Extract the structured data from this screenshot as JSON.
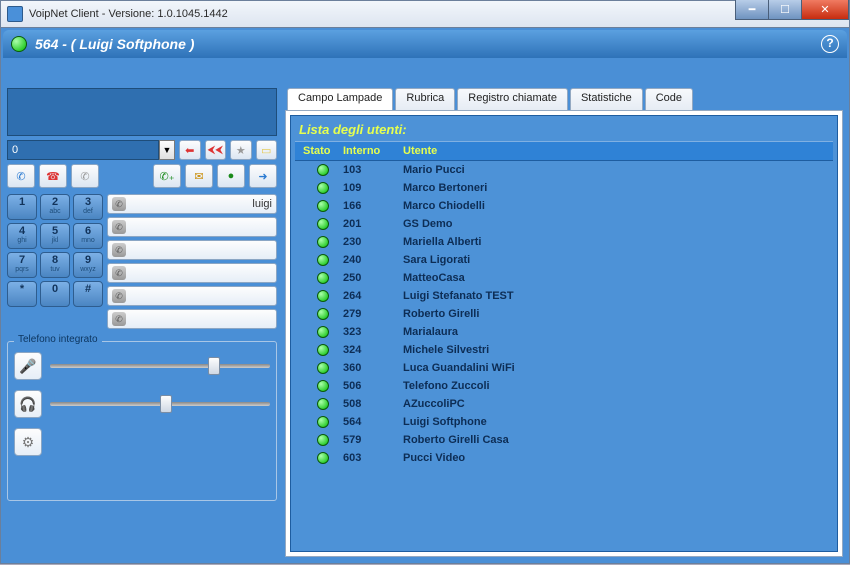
{
  "window": {
    "title": "VoipNet Client - Versione: 1.0.1045.1442"
  },
  "header": {
    "title": "564 - ( Luigi Softphone )"
  },
  "left": {
    "number_input": "0",
    "presence_first": "luigi",
    "dialkeys": [
      {
        "d": "1",
        "s": ""
      },
      {
        "d": "2",
        "s": "abc"
      },
      {
        "d": "3",
        "s": "def"
      },
      {
        "d": "4",
        "s": "ghi"
      },
      {
        "d": "5",
        "s": "jkl"
      },
      {
        "d": "6",
        "s": "mno"
      },
      {
        "d": "7",
        "s": "pqrs"
      },
      {
        "d": "8",
        "s": "tuv"
      },
      {
        "d": "9",
        "s": "wxyz"
      },
      {
        "d": "*",
        "s": ""
      },
      {
        "d": "0",
        "s": ""
      },
      {
        "d": "#",
        "s": ""
      }
    ],
    "group_label": "Telefono integrato",
    "mic_pos_pct": 72,
    "spk_pos_pct": 50
  },
  "tabs": [
    "Campo Lampade",
    "Rubrica",
    "Registro chiamate",
    "Statistiche",
    "Code"
  ],
  "list": {
    "panel_title": "Lista degli utenti:",
    "headers": {
      "stato": "Stato",
      "interno": "Interno",
      "utente": "Utente"
    },
    "rows": [
      {
        "interno": "103",
        "utente": "Mario Pucci"
      },
      {
        "interno": "109",
        "utente": "Marco Bertoneri"
      },
      {
        "interno": "166",
        "utente": "Marco Chiodelli"
      },
      {
        "interno": "201",
        "utente": "GS Demo"
      },
      {
        "interno": "230",
        "utente": "Mariella Alberti"
      },
      {
        "interno": "240",
        "utente": "Sara Ligorati"
      },
      {
        "interno": "250",
        "utente": "MatteoCasa"
      },
      {
        "interno": "264",
        "utente": "Luigi Stefanato TEST"
      },
      {
        "interno": "279",
        "utente": "Roberto Girelli"
      },
      {
        "interno": "323",
        "utente": "Marialaura"
      },
      {
        "interno": "324",
        "utente": "Michele Silvestri"
      },
      {
        "interno": "360",
        "utente": "Luca Guandalini WiFi"
      },
      {
        "interno": "506",
        "utente": "Telefono Zuccoli"
      },
      {
        "interno": "508",
        "utente": "AZuccoliPC"
      },
      {
        "interno": "564",
        "utente": "Luigi Softphone"
      },
      {
        "interno": "579",
        "utente": "Roberto Girelli Casa"
      },
      {
        "interno": "603",
        "utente": "Pucci Video"
      }
    ]
  }
}
